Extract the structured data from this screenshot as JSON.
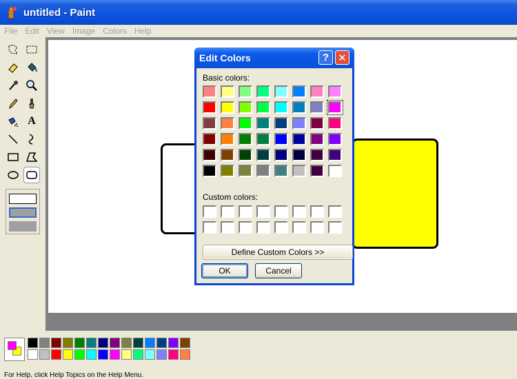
{
  "window": {
    "title": "untitled - Paint"
  },
  "menu": [
    "File",
    "Edit",
    "View",
    "Image",
    "Colors",
    "Help"
  ],
  "status": {
    "text": "For Help, click Help Topics on the Help Menu."
  },
  "tools": [
    {
      "name": "free-form-select-icon"
    },
    {
      "name": "select-icon"
    },
    {
      "name": "eraser-icon"
    },
    {
      "name": "fill-bucket-icon"
    },
    {
      "name": "pick-color-icon"
    },
    {
      "name": "magnifier-icon"
    },
    {
      "name": "pencil-icon"
    },
    {
      "name": "brush-icon"
    },
    {
      "name": "airbrush-icon"
    },
    {
      "name": "text-icon",
      "label": "A"
    },
    {
      "name": "line-icon"
    },
    {
      "name": "curve-icon"
    },
    {
      "name": "rectangle-icon"
    },
    {
      "name": "polygon-icon"
    },
    {
      "name": "ellipse-icon"
    },
    {
      "name": "rounded-rectangle-icon",
      "active": true
    }
  ],
  "palette": {
    "foreground": "#ff00ff",
    "background": "#ffff00",
    "row1": [
      "#000000",
      "#808080",
      "#800000",
      "#808000",
      "#008000",
      "#008080",
      "#000080",
      "#800080",
      "#808040",
      "#004040",
      "#0080ff",
      "#004080",
      "#8000ff",
      "#804000"
    ],
    "row2": [
      "#ffffff",
      "#c0c0c0",
      "#ff0000",
      "#ffff00",
      "#00ff00",
      "#00ffff",
      "#0000ff",
      "#ff00ff",
      "#ffff80",
      "#00ff80",
      "#80ffff",
      "#8080ff",
      "#ff0080",
      "#ff8040"
    ]
  },
  "dialog": {
    "title": "Edit Colors",
    "help_label": "?",
    "close_label": "✕",
    "basic_label": "Basic colors:",
    "custom_label": "Custom colors:",
    "define_label": "Define Custom Colors >>",
    "ok_label": "OK",
    "cancel_label": "Cancel",
    "basic_colors": [
      [
        "#ff8080",
        "#ffff80",
        "#80ff80",
        "#00ff80",
        "#80ffff",
        "#0080ff",
        "#ff80c0",
        "#ff80ff"
      ],
      [
        "#ff0000",
        "#ffff00",
        "#80ff00",
        "#00ff40",
        "#00ffff",
        "#0080c0",
        "#8080c0",
        "#ff00ff"
      ],
      [
        "#804040",
        "#ff8040",
        "#00ff00",
        "#008080",
        "#004080",
        "#8080ff",
        "#800040",
        "#ff0080"
      ],
      [
        "#800000",
        "#ff8000",
        "#008000",
        "#008040",
        "#0000ff",
        "#0000a0",
        "#800080",
        "#8000ff"
      ],
      [
        "#400000",
        "#804000",
        "#004000",
        "#004040",
        "#000080",
        "#000040",
        "#400040",
        "#400080"
      ],
      [
        "#000000",
        "#808000",
        "#808040",
        "#808080",
        "#408080",
        "#c0c0c0",
        "#400040",
        "#ffffff"
      ]
    ],
    "selected_cell": [
      1,
      7
    ]
  }
}
